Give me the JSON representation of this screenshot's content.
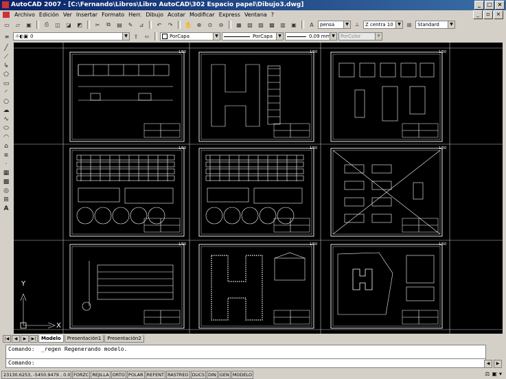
{
  "window": {
    "title": "AutoCAD 2007 - [C:\\Fernando\\Libros\\Libro AutoCAD\\302 Espacio papel\\Dibujo3.dwg]"
  },
  "menu": [
    "Archivo",
    "Edición",
    "Ver",
    "Insertar",
    "Formato",
    "Herr.",
    "Dibujo",
    "Acotar",
    "Modificar",
    "Express",
    "Ventana",
    "?"
  ],
  "toolbar1": {
    "style_combo": "pensa",
    "text_style_combo": "Z centra 10 +",
    "dim_style_combo": "Standard"
  },
  "toolbar2": {
    "layer_combo": "0",
    "color_combo": "PorCapa",
    "linetype_combo": "PorCapa",
    "lineweight_combo": "0.09 mm",
    "plotstyle_combo": "PorColor"
  },
  "sheets": [
    {
      "scale": "1/50"
    },
    {
      "scale": "1/50"
    },
    {
      "scale": "1/50"
    },
    {
      "scale": "1/50"
    },
    {
      "scale": "1/50"
    },
    {
      "scale": "1/50"
    },
    {
      "scale": "1/50"
    },
    {
      "scale": "1/50"
    },
    {
      "scale": "1/50"
    }
  ],
  "ucs": {
    "x_label": "X",
    "y_label": "Y"
  },
  "tabs": [
    "Modelo",
    "Presentación1",
    "Presentación2"
  ],
  "command": {
    "history": "Comando:  _regen Regenerando modelo.",
    "prompt": "Comando:"
  },
  "status": {
    "coordinates": "23130.6253, -5450.9479 , 0.0000",
    "toggles": [
      "FORZC",
      "REJILLA",
      "ORTO",
      "POLAR",
      "REFENT",
      "RASTREO",
      "DUCS",
      "DIN",
      "GEN",
      "MODELO"
    ]
  },
  "colors": {
    "canvas": "#000000",
    "drawing_lines": "#ffffff",
    "grid_lines": "#c8c8c8",
    "titlebar": "#0a246a"
  }
}
